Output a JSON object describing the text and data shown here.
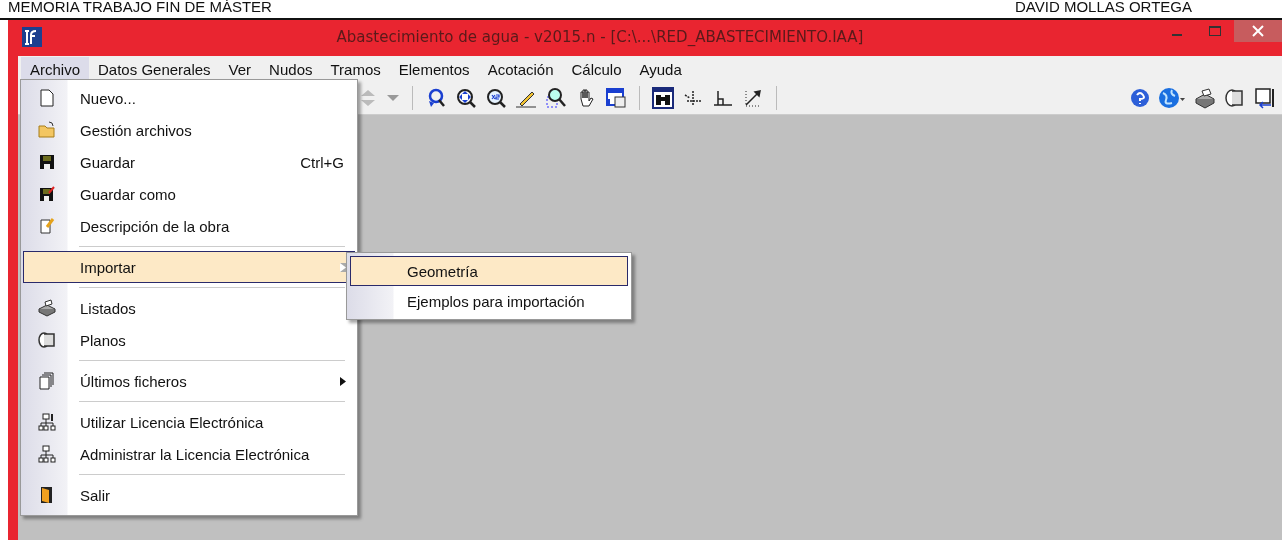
{
  "document_header": {
    "left": "MEMORIA TRABAJO FIN DE MÁSTER",
    "right": "DAVID MOLLAS ORTEGA"
  },
  "window": {
    "title": "Abastecimiento de agua - v2015.n - [C:\\...\\RED_ABASTECIMIENTO.IAA]"
  },
  "menubar": [
    {
      "label": "Archivo",
      "selected": true
    },
    {
      "label": "Datos Generales",
      "selected": false
    },
    {
      "label": "Ver",
      "selected": false
    },
    {
      "label": "Nudos",
      "selected": false
    },
    {
      "label": "Tramos",
      "selected": false
    },
    {
      "label": "Elementos",
      "selected": false
    },
    {
      "label": "Acotación",
      "selected": false
    },
    {
      "label": "Cálculo",
      "selected": false
    },
    {
      "label": "Ayuda",
      "selected": false
    }
  ],
  "file_menu": [
    [
      {
        "label": "Nuevo...",
        "selected": false,
        "submenu": false
      },
      {
        "label": "Gestión archivos",
        "selected": false,
        "submenu": false
      },
      {
        "label": "Guardar",
        "shortcut": "Ctrl+G",
        "selected": false,
        "submenu": false
      },
      {
        "label": "Guardar como",
        "selected": false,
        "submenu": false
      },
      {
        "label": "Descripción de la obra",
        "selected": false,
        "submenu": false
      }
    ],
    [
      {
        "label": "Importar",
        "selected": true,
        "submenu": true
      }
    ],
    [
      {
        "label": "Listados",
        "selected": false,
        "submenu": false
      },
      {
        "label": "Planos",
        "selected": false,
        "submenu": false
      }
    ],
    [
      {
        "label": "Últimos ficheros",
        "selected": false,
        "submenu": true
      }
    ],
    [
      {
        "label": "Utilizar Licencia Electrónica",
        "selected": false,
        "submenu": false
      },
      {
        "label": "Administrar la Licencia Electrónica",
        "selected": false,
        "submenu": false
      }
    ],
    [
      {
        "label": "Salir",
        "selected": false,
        "submenu": false
      }
    ]
  ],
  "import_submenu": [
    {
      "label": "Geometría",
      "selected": true
    },
    {
      "label": "Ejemplos para importación",
      "selected": false
    }
  ]
}
